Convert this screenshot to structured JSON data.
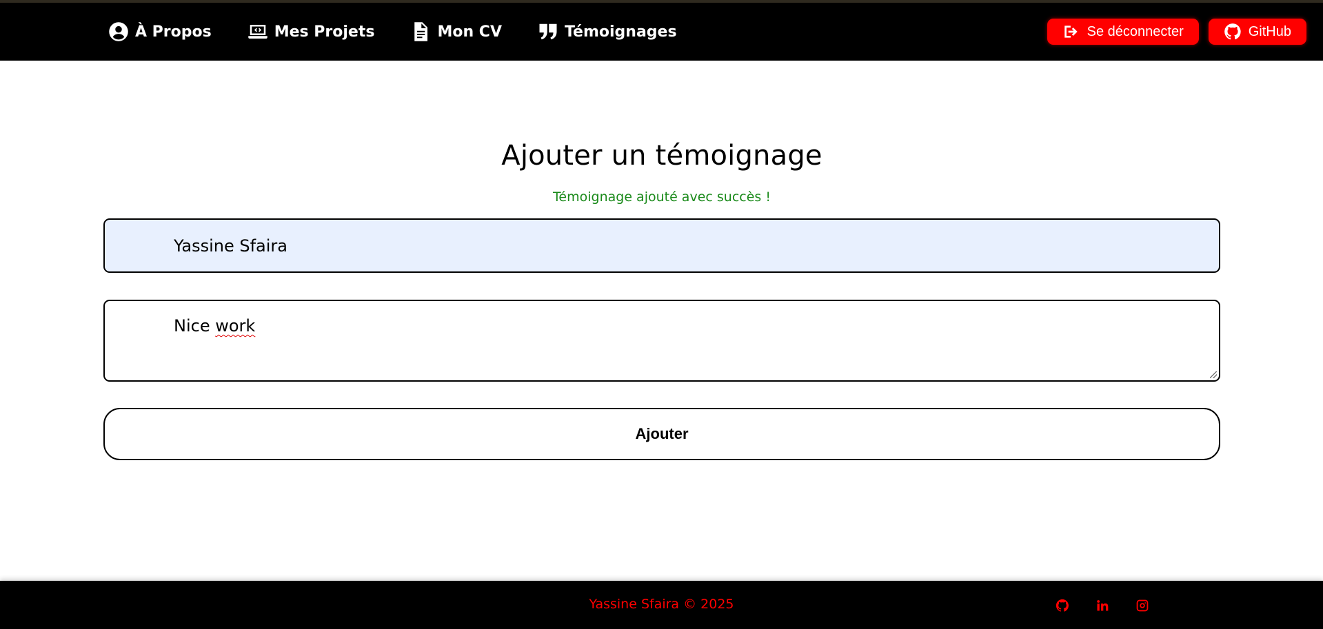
{
  "nav": {
    "links": [
      {
        "label": "À Propos",
        "icon": "user-circle-icon"
      },
      {
        "label": "Mes Projets",
        "icon": "laptop-code-icon"
      },
      {
        "label": "Mon CV",
        "icon": "document-icon"
      },
      {
        "label": "Témoignages",
        "icon": "quote-icon"
      }
    ],
    "logout_label": "Se déconnecter",
    "github_label": "GitHub"
  },
  "main": {
    "title": "Ajouter un témoignage",
    "success_message": "Témoignage ajouté avec succès !",
    "name_value": "Yassine Sfaira",
    "message_first_word": "Nice",
    "message_second_word": "work",
    "submit_label": "Ajouter"
  },
  "footer": {
    "copyright": "Yassine Sfaira © 2025",
    "social_icons": [
      "github-icon",
      "linkedin-icon",
      "instagram-icon"
    ]
  },
  "colors": {
    "accent": "#ff0000",
    "nav_background": "#000000",
    "success": "#1a8a1a",
    "autofill_background": "#e8f0fe"
  }
}
